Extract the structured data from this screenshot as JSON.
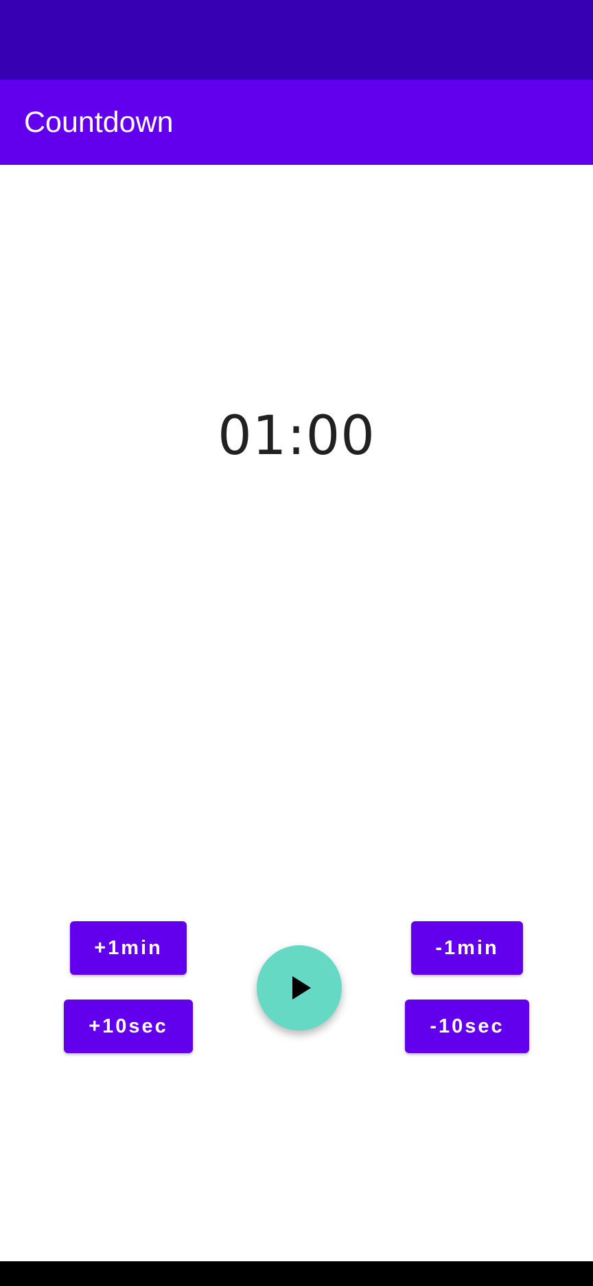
{
  "app_bar": {
    "title": "Countdown"
  },
  "timer": {
    "display": "01:00"
  },
  "controls": {
    "plus_1min_label": "+1min",
    "plus_10sec_label": "+10sec",
    "minus_1min_label": "-1min",
    "minus_10sec_label": "-10sec",
    "play_icon": "play-icon"
  },
  "colors": {
    "status_bar": "#3700B3",
    "primary": "#6200EE",
    "fab": "#66D9C5",
    "timer_text": "#212121"
  }
}
